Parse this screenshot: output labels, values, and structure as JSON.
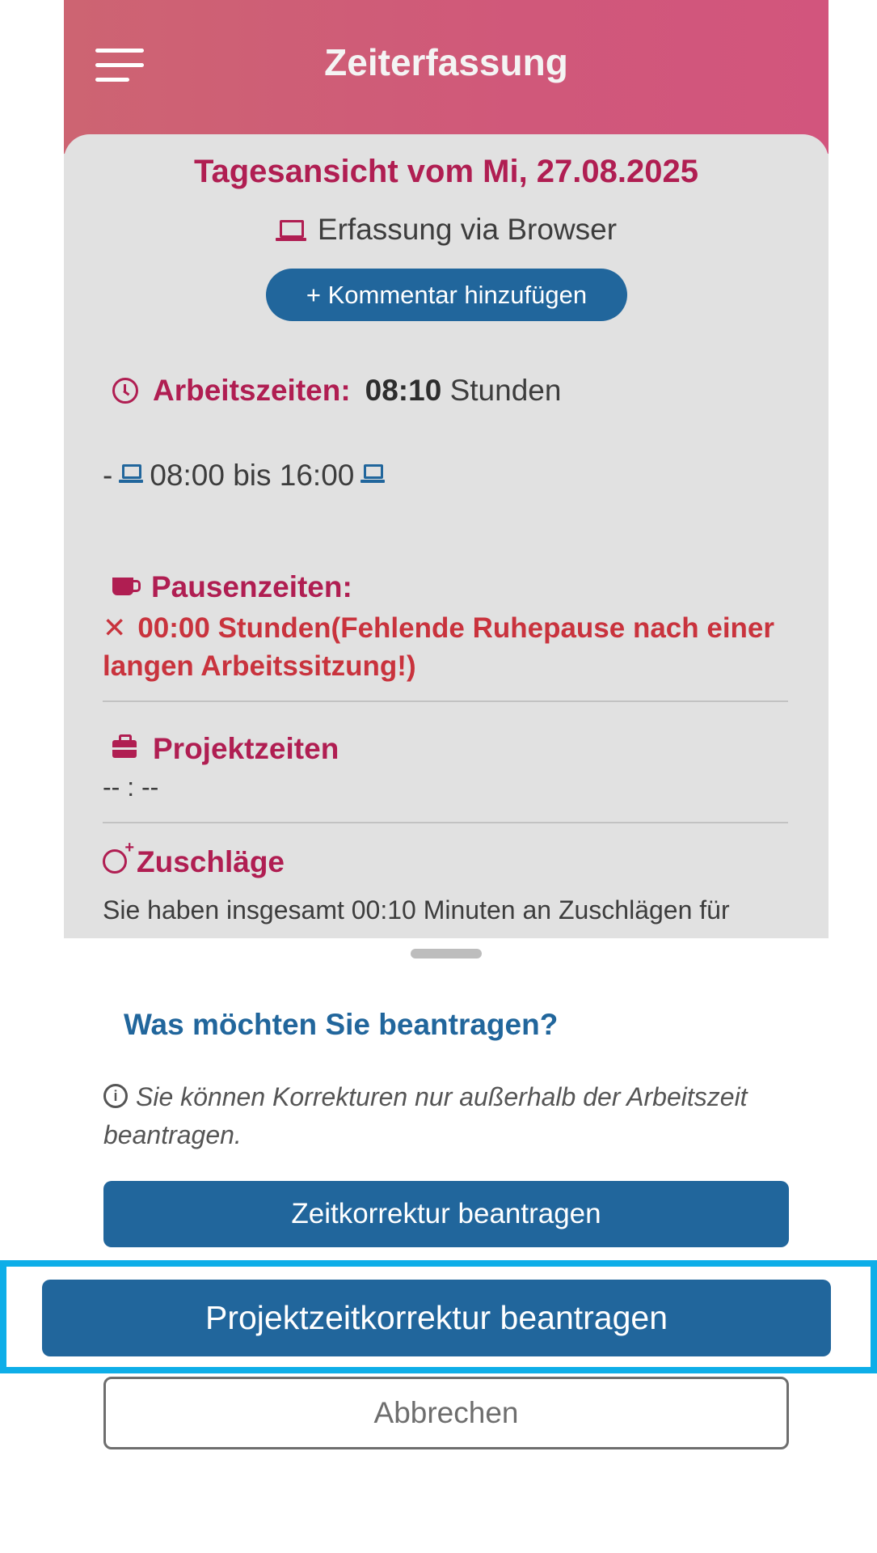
{
  "header": {
    "title": "Zeiterfassung",
    "menu_icon": "hamburger-menu-icon",
    "colors": {
      "gradient_start": "#cd6472",
      "gradient_end": "#d2557d"
    }
  },
  "day_view": {
    "title": "Tagesansicht vom Mi, 27.08.2025",
    "capture_method": "Erfassung via Browser",
    "capture_icon": "laptop-icon",
    "comment_button": "+ Kommentar hinzufügen",
    "work_times": {
      "label": "Arbeitszeiten:",
      "hours": "08:10",
      "unit": "Stunden",
      "icon": "clock-icon",
      "entry_prefix": "-",
      "entry_time": "08:00 bis 16:00"
    },
    "pause_times": {
      "label": "Pausenzeiten:",
      "icon": "coffee-cup-icon",
      "status_icon": "close-x-icon",
      "warning": "00:00 Stunden(Fehlende Ruhepause nach einer langen Arbeitssitzung!)"
    },
    "project_times": {
      "label": "Projektzeiten",
      "icon": "briefcase-icon",
      "value": "-- : --"
    },
    "surcharges": {
      "label": "Zuschläge",
      "icon": "alarm-add-icon",
      "text": "Sie haben insgesamt 00:10 Minuten an Zuschlägen für"
    },
    "colors": {
      "accent": "#b01e52",
      "primary": "#21669c",
      "warning": "#c9333d"
    }
  },
  "sheet": {
    "title": "Was möchten Sie beantragen?",
    "info_icon": "info-icon",
    "info_text": "Sie können Korrekturen nur außerhalb der Arbeitszeit beantragen.",
    "time_correction_button": "Zeitkorrektur beantragen",
    "project_correction_button": "Projektzeitkorrektur beantragen",
    "cancel_button": "Abbrechen",
    "highlight_color": "#0eaee8"
  }
}
